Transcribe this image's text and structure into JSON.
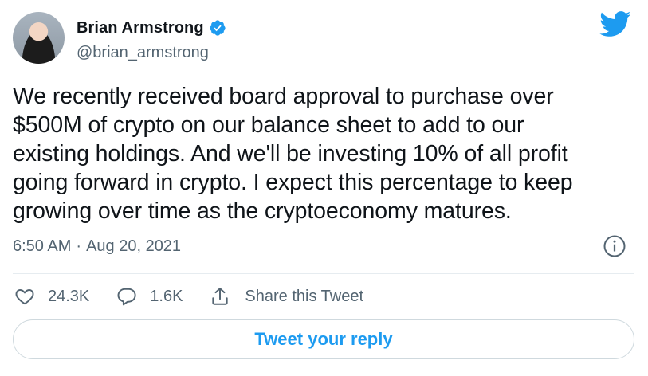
{
  "author": {
    "name": "Brian Armstrong",
    "handle": "@brian_armstrong",
    "verified_icon": "verified-badge-icon"
  },
  "tweet": {
    "text": "We recently received board approval to purchase over\n$500M of crypto on our balance sheet to add to our\nexisting holdings. And we'll be investing 10% of all profit\ngoing forward in crypto. I expect this percentage to keep\ngrowing over time as the cryptoeconomy matures.",
    "time": "6:50 AM",
    "separator": "·",
    "date": "Aug 20, 2021"
  },
  "actions": {
    "likes": "24.3K",
    "replies": "1.6K",
    "share_label": "Share this Tweet"
  },
  "reply": {
    "label": "Tweet your reply"
  },
  "colors": {
    "accent": "#1d9bf0",
    "text": "#0f1419",
    "muted": "#536471",
    "border": "#cfd9de"
  }
}
